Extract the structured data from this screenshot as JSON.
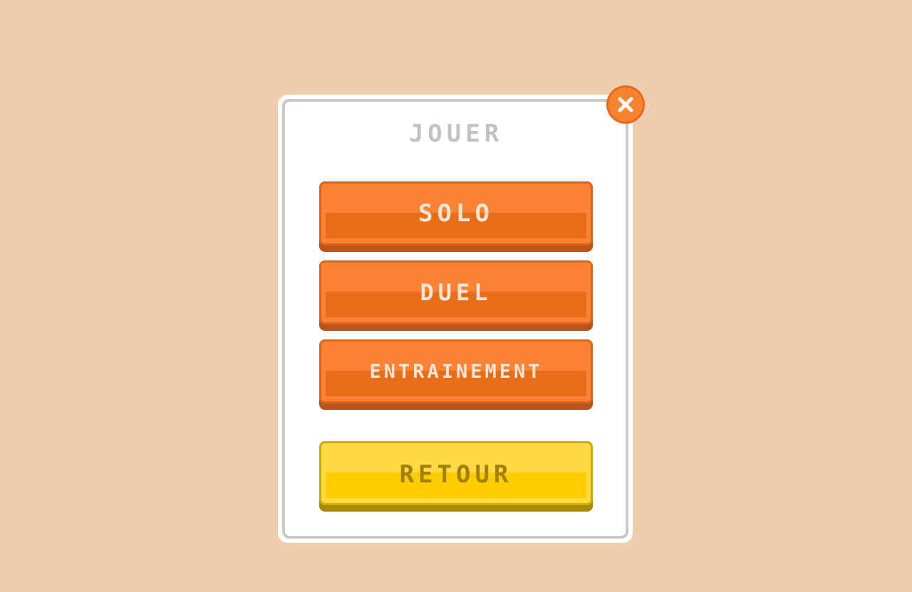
{
  "dialog": {
    "title": "JOUER",
    "close_icon": "close-x-icon",
    "buttons": {
      "solo": "SOLO",
      "duel": "DUEL",
      "training": "ENTRAINEMENT",
      "back": "RETOUR"
    }
  },
  "colors": {
    "background": "#efcdad",
    "primary_button": "#fa8234",
    "secondary_button": "#ffda45",
    "close_button": "#e8691b",
    "title": "#c2c2c2"
  }
}
